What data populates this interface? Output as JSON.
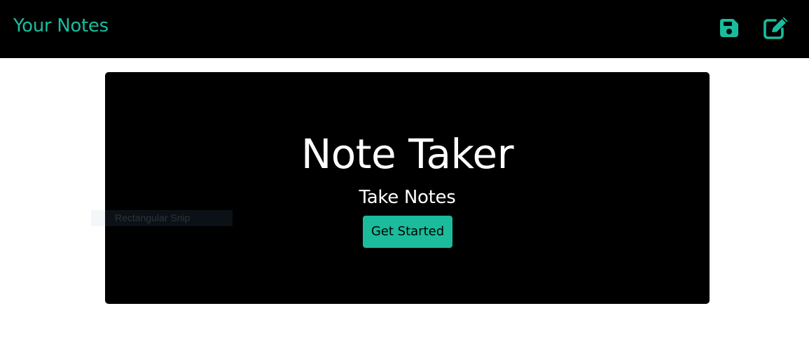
{
  "navbar": {
    "brand": "Your Notes",
    "save_icon": "save-icon",
    "write_icon": "pen-to-square-icon"
  },
  "hero": {
    "title": "Note Taker",
    "subtitle": "Take Notes",
    "cta_label": "Get Started"
  },
  "overlay": {
    "tooltip": "Rectangular Snip"
  },
  "colors": {
    "accent": "#1abc9c",
    "navbar_bg": "#000000",
    "hero_bg": "#000000",
    "page_bg": "#ffffff"
  }
}
